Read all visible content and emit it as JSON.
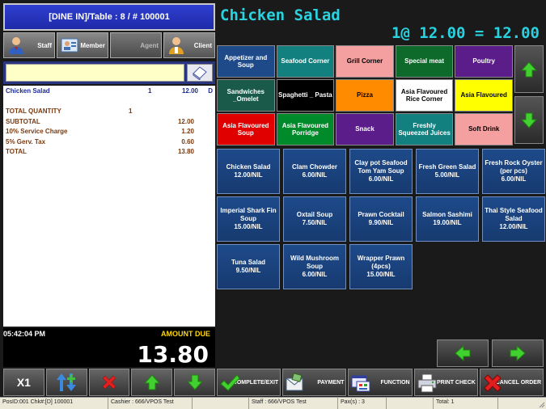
{
  "order": {
    "header": "[DINE IN]/Table : 8 / # 100001",
    "staff_buttons": [
      {
        "label": "Staff",
        "icon": "person-icon"
      },
      {
        "label": "Member",
        "icon": "member-card-icon"
      },
      {
        "label": "Agent",
        "icon": ""
      },
      {
        "label": "Client",
        "icon": "client-person-icon"
      }
    ],
    "search_value": "",
    "items": [
      {
        "name": "Chicken Salad",
        "qty": "1",
        "price": "12.00",
        "status": "D"
      }
    ],
    "totals": [
      {
        "label": "TOTAL QUANTITY",
        "qty": "1",
        "value": ""
      },
      {
        "label": "SUBTOTAL",
        "qty": "",
        "value": "12.00"
      },
      {
        "label": "10% Service Charge",
        "qty": "",
        "value": "1.20"
      },
      {
        "label": "5% Gerv. Tax",
        "qty": "",
        "value": "0.60"
      },
      {
        "label": "TOTAL",
        "qty": "",
        "value": "13.80"
      }
    ],
    "clock": "05:42:04 PM",
    "amount_label": "AMOUNT DUE",
    "amount_value": "13.80",
    "controls": {
      "multiply": "X1"
    }
  },
  "selected_item": {
    "name": "Chicken Salad",
    "calc": "1@ 12.00 = 12.00"
  },
  "categories": [
    {
      "label": "Appetizer and Soup",
      "color": "#1e4a8a",
      "text": "white"
    },
    {
      "label": "Seafood Corner",
      "color": "#138080",
      "text": "white"
    },
    {
      "label": "Grill Corner",
      "color": "#f4a0a0",
      "text": "black"
    },
    {
      "label": "Special meat",
      "color": "#0d6a2a",
      "text": "white"
    },
    {
      "label": "Poultry",
      "color": "#5a1d8a",
      "text": "white"
    },
    {
      "label": "Sandwiches _Omelet",
      "color": "#1a5a4a",
      "text": "white"
    },
    {
      "label": "Spaghetti _ Pasta",
      "color": "#000000",
      "text": "white"
    },
    {
      "label": "Pizza",
      "color": "#ff8c00",
      "text": "black"
    },
    {
      "label": "Asia Flavoured Rice Corner",
      "color": "#ffffff",
      "text": "black"
    },
    {
      "label": "Asia Flavoured",
      "color": "#ffff00",
      "text": "black"
    },
    {
      "label": "Asia Flavoured Soup",
      "color": "#e00000",
      "text": "white"
    },
    {
      "label": "Asia Flavoured Porridge",
      "color": "#008a2a",
      "text": "white"
    },
    {
      "label": "Snack",
      "color": "#5a1d8a",
      "text": "white"
    },
    {
      "label": "Freshly Squeezed Juices",
      "color": "#138080",
      "text": "white"
    },
    {
      "label": "Soft Drink",
      "color": "#f4a0a0",
      "text": "black"
    }
  ],
  "menu_items": [
    {
      "label": "Chicken Salad",
      "price": "12.00/NIL"
    },
    {
      "label": "Clam Chowder",
      "price": "6.00/NIL"
    },
    {
      "label": "Clay pot Seafood Tom Yam Soup",
      "price": "6.00/NIL"
    },
    {
      "label": "Fresh Green Salad",
      "price": "5.00/NIL"
    },
    {
      "label": "Fresh Rock Oyster (per pcs)",
      "price": "6.00/NIL"
    },
    {
      "label": "Imperial Shark Fin Soup",
      "price": "15.00/NIL"
    },
    {
      "label": "Oxtail Soup",
      "price": "7.50/NIL"
    },
    {
      "label": "Prawn Cocktail",
      "price": "9.90/NIL"
    },
    {
      "label": "Salmon Sashimi",
      "price": "19.00/NIL"
    },
    {
      "label": "Thai Style Seafood Salad",
      "price": "12.00/NIL"
    },
    {
      "label": "Tuna Salad",
      "price": "9.50/NIL"
    },
    {
      "label": "Wild Mushroom Soup",
      "price": "6.00/NIL"
    },
    {
      "label": "Wrapper Prawn (4pcs)",
      "price": "15.00/NIL"
    }
  ],
  "actions": [
    {
      "label": "COMPLETE/EXIT",
      "icon": "checkmark-icon"
    },
    {
      "label": "PAYMENT",
      "icon": "envelope-payment-icon"
    },
    {
      "label": "FUNCTION",
      "icon": "function-window-icon"
    },
    {
      "label": "PRINT CHECK",
      "icon": "printer-icon"
    },
    {
      "label": "CANCEL ORDER",
      "icon": "cancel-x-icon"
    }
  ],
  "status_bar": [
    "PosID:001 Chk#:[D] 100001",
    "Cashier : 666/VPOS Test",
    "",
    "Staff : 666/VPOS Test",
    "Pax(s) : 3",
    "",
    "Total: 1",
    ""
  ]
}
